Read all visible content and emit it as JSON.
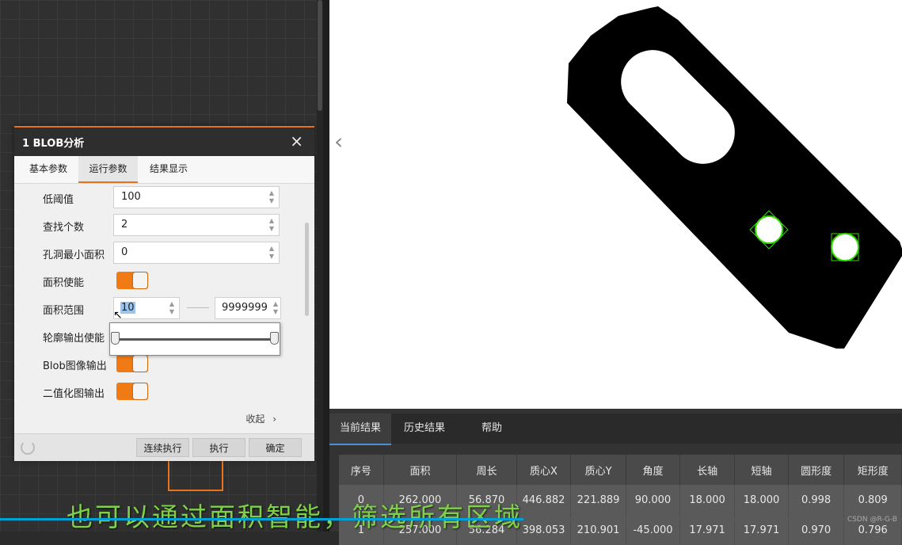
{
  "dialog": {
    "title": "1 BLOB分析",
    "close_icon": "×",
    "tabs": [
      "基本参数",
      "运行参数",
      "结果显示"
    ],
    "active_tab": "运行参数",
    "params": {
      "low_threshold_label": "低阈值",
      "low_threshold_value": "100",
      "find_count_label": "查找个数",
      "find_count_value": "2",
      "hole_min_area_label": "孔洞最小面积",
      "hole_min_area_value": "0",
      "area_enable_label": "面积使能",
      "area_range_label": "面积范围",
      "area_range_min": "10",
      "area_range_max": "9999999",
      "contour_output_label": "轮廓输出使能",
      "blob_image_output_label": "Blob图像输出",
      "binary_image_output_label": "二值化图输出"
    },
    "collapse_label": "收起",
    "footer": {
      "continuous_run": "连续执行",
      "run": "执行",
      "confirm": "确定"
    }
  },
  "results": {
    "tabs": [
      "当前结果",
      "历史结果",
      "帮助"
    ],
    "columns": [
      "序号",
      "面积",
      "周长",
      "质心X",
      "质心Y",
      "角度",
      "长轴",
      "短轴",
      "圆形度",
      "矩形度"
    ],
    "rows": [
      [
        "0",
        "262.000",
        "56.870",
        "446.882",
        "221.889",
        "90.000",
        "18.000",
        "18.000",
        "0.998",
        "0.809"
      ],
      [
        "1",
        "257.000",
        "56.284",
        "398.053",
        "210.901",
        "-45.000",
        "17.971",
        "17.971",
        "0.970",
        "0.796"
      ]
    ]
  },
  "caption": "也可以通过面积智能，筛选所有区域",
  "watermark": "CSDN @R-G-B",
  "video_progress": 0.58,
  "colors": {
    "accent": "#e8731a",
    "toggle_on": "#f07a14",
    "overlay_green": "#33dd00"
  }
}
